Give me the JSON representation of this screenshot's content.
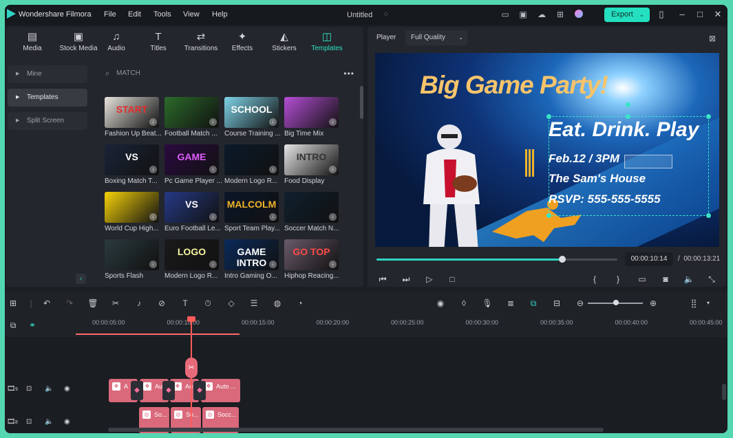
{
  "app": {
    "name": "Wondershare Filmora",
    "doc_title": "Untitled",
    "export_label": "Export"
  },
  "menu": [
    "File",
    "Edit",
    "Tools",
    "View",
    "Help"
  ],
  "categories": [
    "Media",
    "Stock Media",
    "Audio",
    "Titles",
    "Transitions",
    "Effects",
    "Stickers",
    "Templates"
  ],
  "sidebar": [
    "Mine",
    "Templates",
    "Split Screen"
  ],
  "search": {
    "value": "MATCH"
  },
  "templates": [
    {
      "label": "Fashion Up Beat...",
      "thumb_text": "START",
      "bg": "#e8e3dc",
      "fg": "#e52b2b"
    },
    {
      "label": "Football Match ...",
      "thumb_text": "",
      "bg": "#2c6b2a",
      "fg": "#ffffff"
    },
    {
      "label": "Course Training ...",
      "thumb_text": "SCHOOL",
      "bg": "#7fd4e8",
      "fg": "#ffffff"
    },
    {
      "label": "Big Time Mix",
      "thumb_text": "",
      "bg": "#b64fd6",
      "fg": "#ffffff"
    },
    {
      "label": "Boxing Match T...",
      "thumb_text": "VS",
      "bg": "#1a2438",
      "fg": "#ffffff"
    },
    {
      "label": "Pc Game Player ...",
      "thumb_text": "GAME",
      "bg": "#2a0a40",
      "fg": "#e05cff"
    },
    {
      "label": "Modern Logo R...",
      "thumb_text": "",
      "bg": "#0a1a2a",
      "fg": "#8fd2ff"
    },
    {
      "label": "Food Display",
      "thumb_text": "INTRO",
      "bg": "#e6e6e6",
      "fg": "#333333"
    },
    {
      "label": "World Cup High...",
      "thumb_text": "",
      "bg": "#f6d20a",
      "fg": "#1a1a1a"
    },
    {
      "label": "Euro Football Le...",
      "thumb_text": "VS",
      "bg": "#253a86",
      "fg": "#ffffff"
    },
    {
      "label": "Sport Team Play...",
      "thumb_text": "MALCOLM",
      "bg": "#0a1628",
      "fg": "#f0b429"
    },
    {
      "label": "Soccer Match N...",
      "thumb_text": "",
      "bg": "#10202e",
      "fg": "#ffffff"
    },
    {
      "label": "Sports Flash",
      "thumb_text": "",
      "bg": "#2a3a3e",
      "fg": "#ffffff"
    },
    {
      "label": "Modern Logo R...",
      "thumb_text": "LOGO",
      "bg": "#1a1a1a",
      "fg": "#f5f5a0"
    },
    {
      "label": "Intro Gaming O...",
      "thumb_text": "GAME INTRO",
      "bg": "#0a2a5a",
      "fg": "#ffffff"
    },
    {
      "label": "Hiphop Reacing...",
      "thumb_text": "GO TOP",
      "bg": "#6a5a6a",
      "fg": "#ff4a4a"
    }
  ],
  "player": {
    "tab": "Player",
    "quality": "Full Quality",
    "banner": {
      "title": "Big Game Party!",
      "subtitle": "Eat. Drink. Play",
      "date": "Feb.12 / 3PM",
      "place": "The Sam's House",
      "rsvp": "RSVP: 555-555-5555"
    },
    "progress": 0.77,
    "time_current": "00:00:10:14",
    "time_sep": "/",
    "time_total": "00:00:13:21"
  },
  "timeline": {
    "ticks": [
      "00:00:05:00",
      "00:00:10:00",
      "00:00:15:00",
      "00:00:20:00",
      "00:00:25:00",
      "00:00:30:00",
      "00:00:35:00",
      "00:00:40:00",
      "00:00:45:00"
    ],
    "tracks": [
      {
        "num": "9"
      },
      {
        "num": "8"
      }
    ],
    "clips_track9": [
      "A",
      "Au",
      "Au",
      "Auto ..."
    ],
    "clips_track8": [
      "So...",
      "So...",
      "Socc..."
    ]
  },
  "colors": {
    "accent": "#2fd3c4",
    "clip": "#d9697b",
    "playhead": "#ff5b5b"
  }
}
